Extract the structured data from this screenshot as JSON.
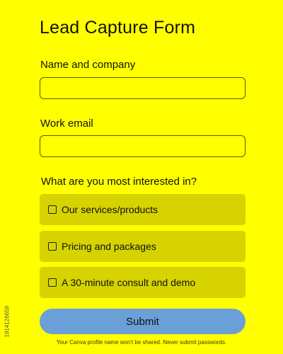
{
  "form": {
    "title": "Lead Capture Form",
    "name_label": "Name and company",
    "name_value": "",
    "email_label": "Work email",
    "email_value": "",
    "question": "What are you most interested in?",
    "options": [
      {
        "label": "Our services/products",
        "checked": false
      },
      {
        "label": "Pricing and packages",
        "checked": false
      },
      {
        "label": "A 30-minute consult and demo",
        "checked": false
      }
    ],
    "submit_label": "Submit",
    "footnote": "Your Canva profile name won't be shared. Never submit passwords."
  },
  "watermark": {
    "side_id": "1914126659"
  },
  "colors": {
    "background": "#ffff00",
    "option_background": "#d6d300",
    "submit_background": "#6b9fd8"
  }
}
